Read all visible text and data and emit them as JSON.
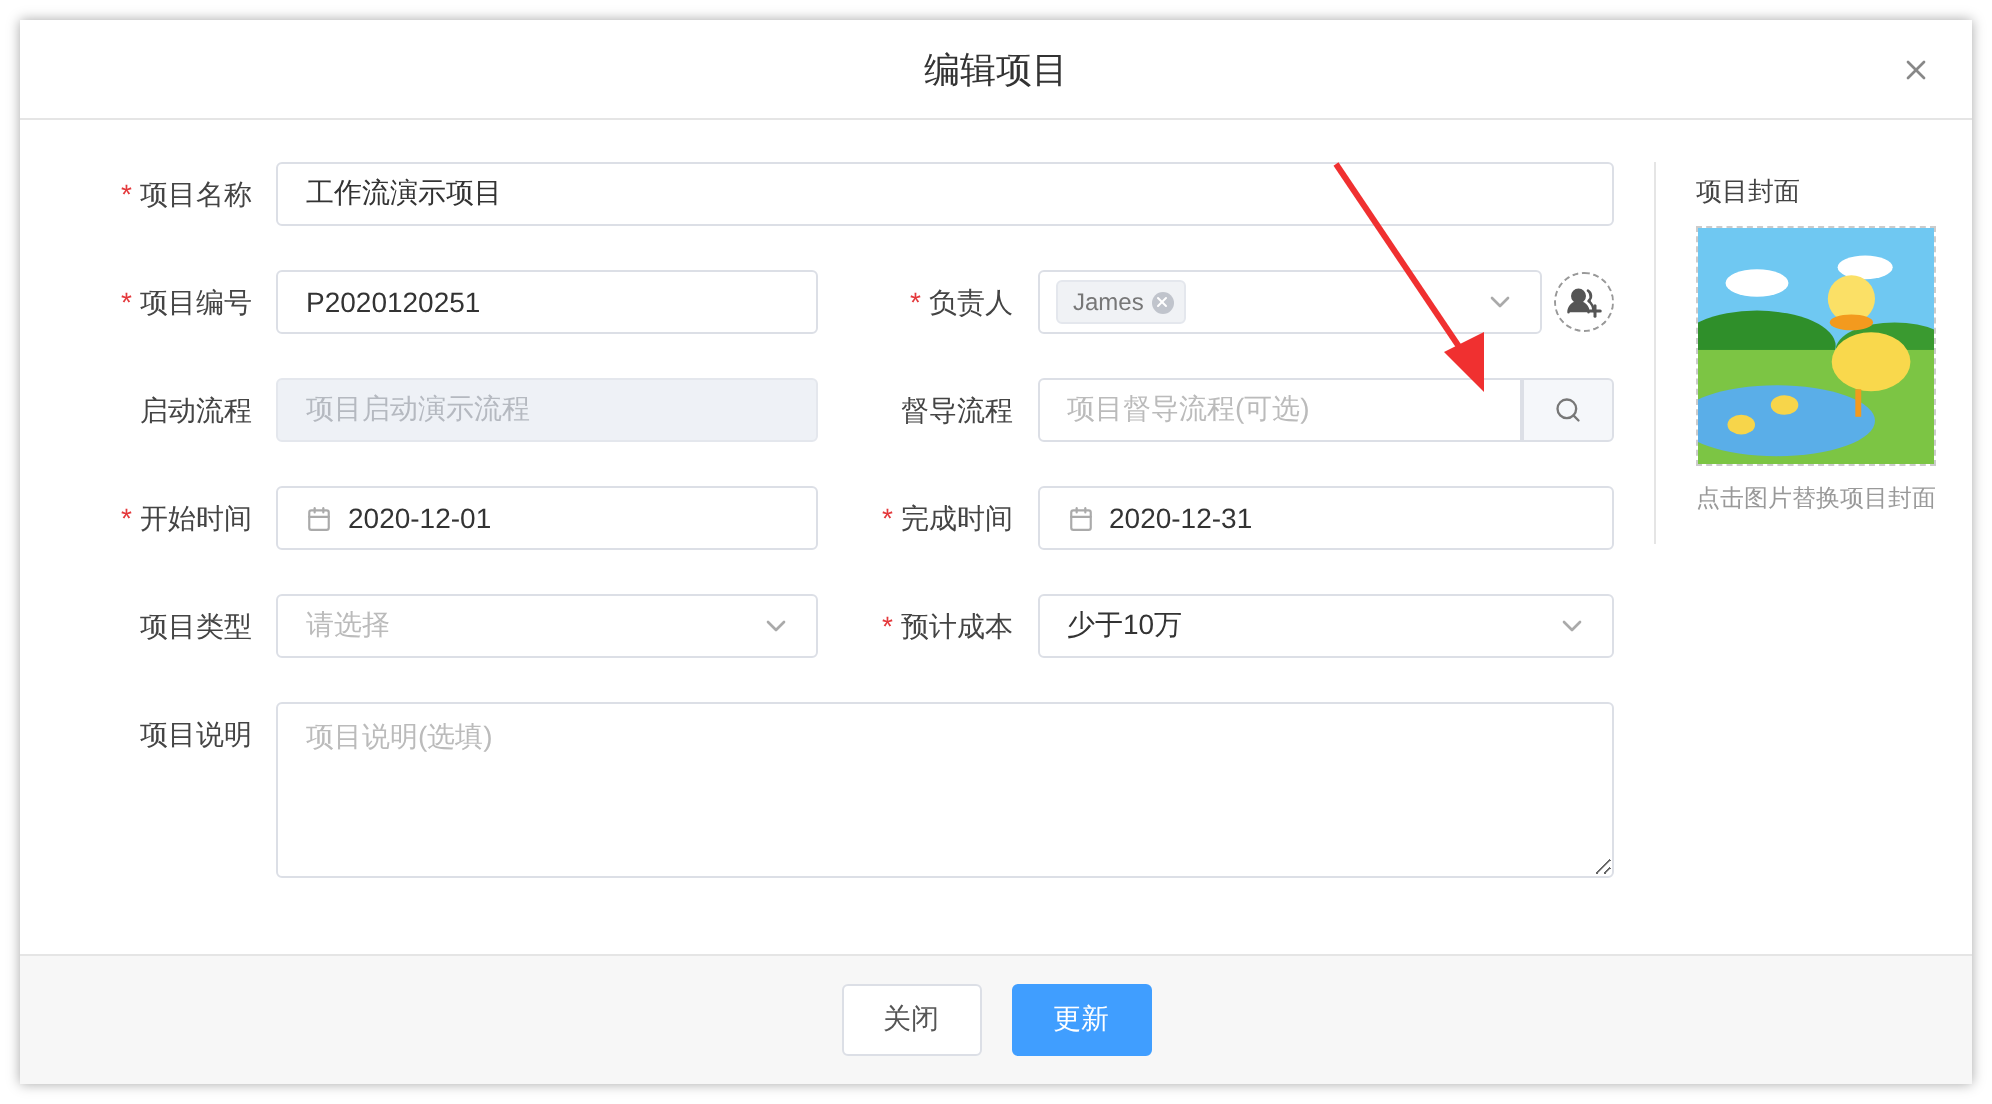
{
  "dialog": {
    "title": "编辑项目"
  },
  "required_mark": "*",
  "rows": [
    [
      {
        "label": "项目名称",
        "required": true,
        "kind": "text",
        "value": "工作流演示项目"
      }
    ],
    [
      {
        "label": "项目编号",
        "required": true,
        "kind": "text",
        "value": "P2020120251"
      },
      {
        "label": "负责人",
        "required": true,
        "kind": "tags",
        "tags": [
          "James"
        ]
      }
    ],
    [
      {
        "label": "启动流程",
        "required": false,
        "kind": "text",
        "disabled": true,
        "placeholder": "项目启动演示流程"
      },
      {
        "label": "督导流程",
        "required": false,
        "kind": "search",
        "placeholder": "项目督导流程(可选)"
      }
    ],
    [
      {
        "label": "开始时间",
        "required": true,
        "kind": "date",
        "value": "2020-12-01"
      },
      {
        "label": "完成时间",
        "required": true,
        "kind": "date",
        "value": "2020-12-31"
      }
    ],
    [
      {
        "label": "项目类型",
        "required": false,
        "kind": "select",
        "placeholder": "请选择"
      },
      {
        "label": "预计成本",
        "required": true,
        "kind": "select",
        "value": "少于10万"
      }
    ],
    [
      {
        "label": "项目说明",
        "required": false,
        "kind": "textarea",
        "placeholder": "项目说明(选填)"
      }
    ]
  ],
  "cover": {
    "title": "项目封面",
    "hint": "点击图片替换项目封面"
  },
  "buttons": [
    {
      "label": "关闭",
      "kind": "default"
    },
    {
      "label": "更新",
      "kind": "primary"
    }
  ]
}
